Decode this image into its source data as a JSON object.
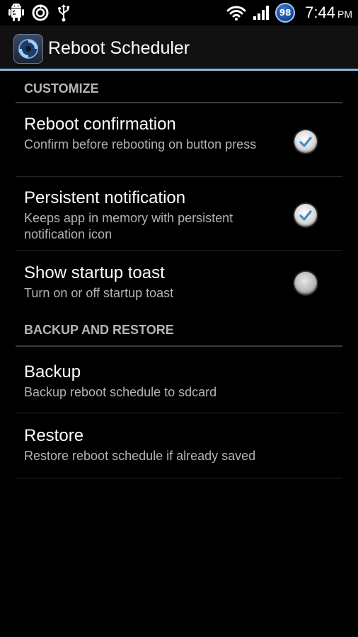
{
  "statusbar": {
    "left_icons": [
      "android-debug-icon",
      "sync-icon",
      "usb-icon"
    ],
    "right_icons": [
      "wifi-icon",
      "signal-icon"
    ],
    "battery": "98",
    "time": "7:44",
    "ampm": "PM"
  },
  "actionbar": {
    "icon": "reboot-scheduler-app-icon",
    "title": "Reboot Scheduler"
  },
  "sections": [
    {
      "header": "CUSTOMIZE",
      "items": [
        {
          "title": "Reboot confirmation",
          "summary": "Confirm before rebooting on button press",
          "checked": true
        },
        {
          "title": "Persistent notification",
          "summary": "Keeps app in memory with persistent notification icon",
          "checked": true
        },
        {
          "title": "Show startup toast",
          "summary": "Turn on or off startup toast",
          "checked": false
        }
      ]
    },
    {
      "header": "BACKUP AND RESTORE",
      "items": [
        {
          "title": "Backup",
          "summary": "Backup reboot schedule to sdcard"
        },
        {
          "title": "Restore",
          "summary": "Restore reboot schedule if already saved"
        }
      ]
    }
  ],
  "colors": {
    "accent": "#8fb7d9",
    "check": "#3b8fd1",
    "header_text": "#b5b5b5",
    "summary_text": "#b3b3b3"
  }
}
